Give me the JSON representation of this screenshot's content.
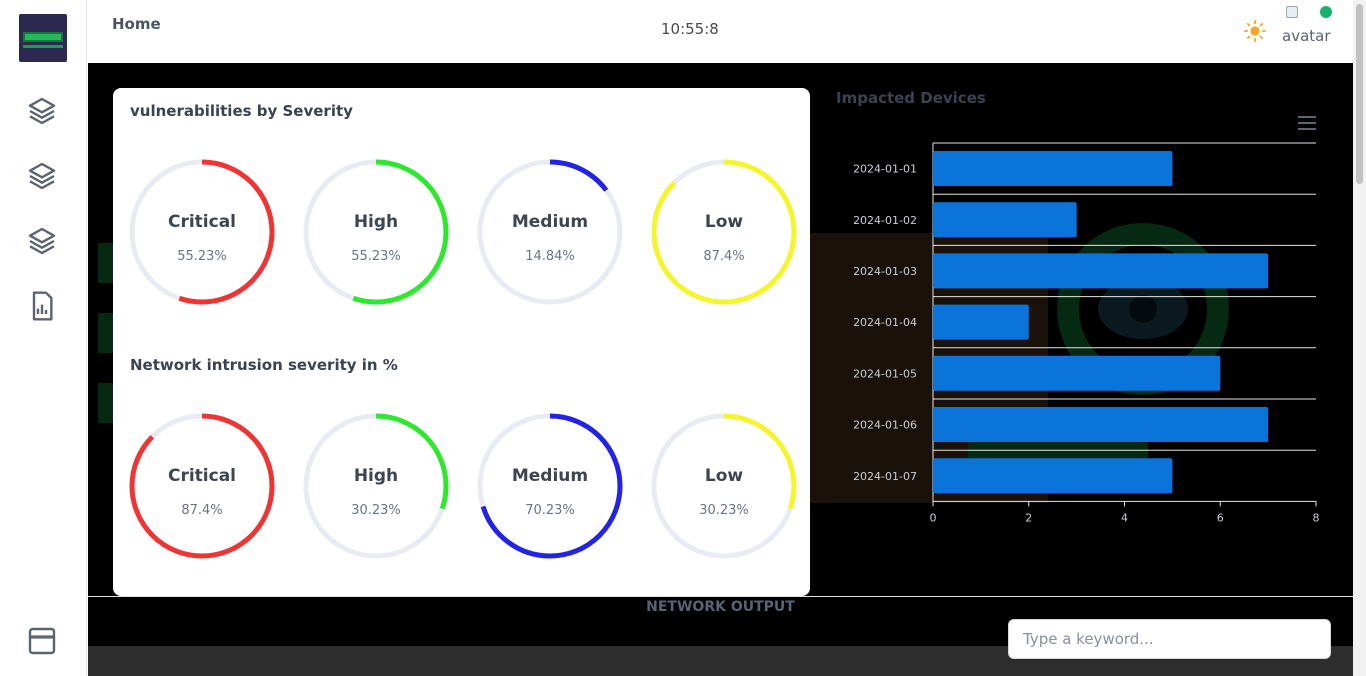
{
  "header": {
    "title": "Home",
    "clock": "10:55:8",
    "avatar_alt": "avatar"
  },
  "sidebar": {
    "items": [
      {
        "icon": "layers-icon"
      },
      {
        "icon": "layers-icon"
      },
      {
        "icon": "layers-icon"
      },
      {
        "icon": "report-icon"
      }
    ],
    "bottom_icon": "window-icon"
  },
  "vuln_card": {
    "title": "vulnerabilities by Severity",
    "gauges": [
      {
        "label": "Critical",
        "pct_text": "55.23%",
        "value": 55.23,
        "color": "#f03434"
      },
      {
        "label": "High",
        "pct_text": "55.23%",
        "value": 55.23,
        "color": "#2ee82e"
      },
      {
        "label": "Medium",
        "pct_text": "14.84%",
        "value": 14.84,
        "color": "#2323e6"
      },
      {
        "label": "Low",
        "pct_text": "87.4%",
        "value": 87.4,
        "color": "#f5f52b"
      }
    ]
  },
  "intrusion_card": {
    "title": "Network intrusion severity in %",
    "gauges": [
      {
        "label": "Critical",
        "pct_text": "87.4%",
        "value": 87.4,
        "color": "#f03434"
      },
      {
        "label": "High",
        "pct_text": "30.23%",
        "value": 30.23,
        "color": "#2ee82e"
      },
      {
        "label": "Medium",
        "pct_text": "70.23%",
        "value": 70.23,
        "color": "#2323e6"
      },
      {
        "label": "Low",
        "pct_text": "30.23%",
        "value": 30.23,
        "color": "#f5f52b"
      }
    ]
  },
  "chart_data": {
    "type": "bar",
    "orientation": "horizontal",
    "title": "Impacted Devices",
    "categories": [
      "2024-01-01",
      "2024-01-02",
      "2024-01-03",
      "2024-01-04",
      "2024-01-05",
      "2024-01-06",
      "2024-01-07"
    ],
    "values": [
      5,
      3,
      7,
      2,
      6,
      7,
      5
    ],
    "xlim": [
      0,
      8
    ],
    "xticks": [
      "0",
      "2",
      "4",
      "6",
      "8"
    ],
    "color": "#0a74da",
    "grid": true
  },
  "output": {
    "title": "NETWORK OUTPUT",
    "search_placeholder": "Type a keyword..."
  }
}
